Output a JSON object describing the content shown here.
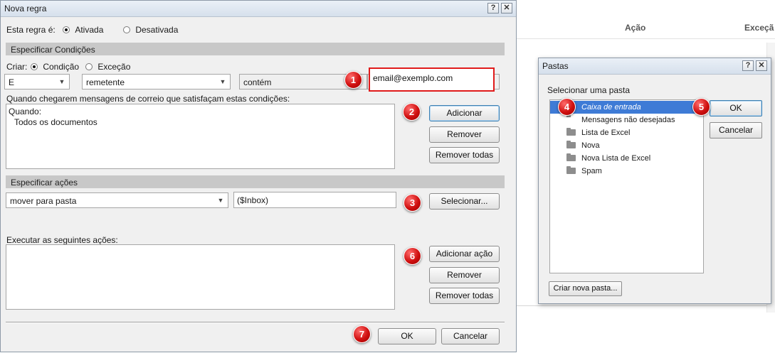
{
  "background": {
    "col_action": "Ação",
    "col_exception": "Exceçã"
  },
  "rule_dialog": {
    "title": "Nova regra",
    "help_label": "?",
    "close_label": "✕",
    "rule_is_label": "Esta regra é:",
    "status_active": "Ativada",
    "status_inactive": "Desativada",
    "conditions_header": "Especificar Condições",
    "create_label": "Criar:",
    "create_condition": "Condição",
    "create_exception": "Exceção",
    "cond_logic": "E",
    "cond_field": "remetente",
    "cond_operator": "contém",
    "cond_value": "email@exemplo.com",
    "conditions_desc": "Quando chegarem mensagens de correio que satisfaçam estas condições:",
    "conditions_list": [
      "Quando:",
      "Todos os documentos"
    ],
    "add_button": "Adicionar",
    "remove_button": "Remover",
    "remove_all_button": "Remover todas",
    "actions_header": "Especificar ações",
    "action_type": "mover para pasta",
    "action_target": "($Inbox)",
    "select_button": "Selecionar...",
    "execute_label": "Executar as seguintes ações:",
    "add_action_button": "Adicionar ação",
    "remove_action_button": "Remover",
    "remove_all_actions_button": "Remover todas",
    "ok_button": "OK",
    "cancel_button": "Cancelar"
  },
  "folder_dialog": {
    "title": "Pastas",
    "help_label": "?",
    "close_label": "✕",
    "select_label": "Selecionar uma pasta",
    "folders": [
      {
        "name": "Caixa de entrada",
        "selected": true,
        "icon": "folder-icon"
      },
      {
        "name": "Mensagens não desejadas",
        "selected": false,
        "icon": "folder-icon"
      },
      {
        "name": "Lista de Excel",
        "selected": false,
        "icon": "folder-icon"
      },
      {
        "name": "Nova",
        "selected": false,
        "icon": "folder-icon"
      },
      {
        "name": "Nova Lista de Excel",
        "selected": false,
        "icon": "folder-icon"
      },
      {
        "name": "Spam",
        "selected": false,
        "icon": "folder-icon"
      }
    ],
    "ok_button": "OK",
    "cancel_button": "Cancelar",
    "new_folder_button": "Criar nova pasta..."
  },
  "markers": [
    "1",
    "2",
    "3",
    "4",
    "5",
    "6",
    "7"
  ],
  "colors": {
    "highlight_box": "#e01b1b",
    "selection": "#3e7bd6",
    "marker": "#d01010",
    "section_bar": "#c8c8c8"
  }
}
